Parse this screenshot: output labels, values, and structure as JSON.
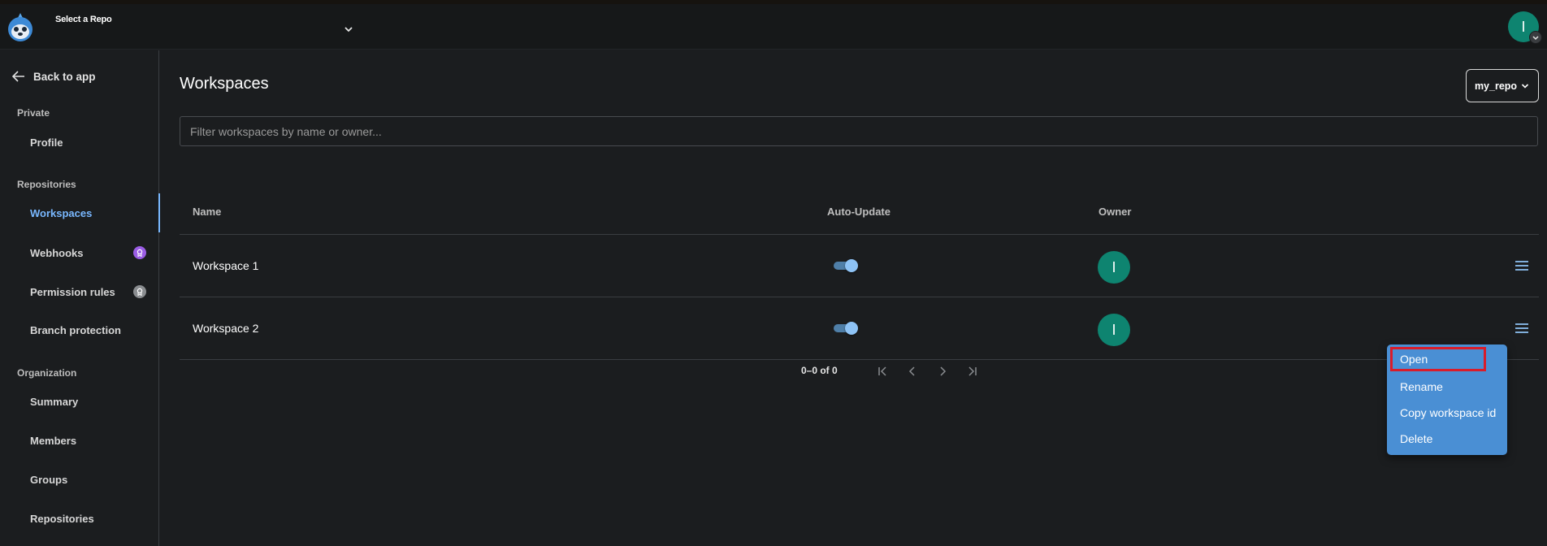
{
  "topbar": {
    "repo_selector_label": "Select a Repo",
    "user_initial": "I"
  },
  "sidebar": {
    "back_label": "Back to app",
    "sections": [
      {
        "title": "Private",
        "items": [
          {
            "label": "Profile"
          }
        ]
      },
      {
        "title": "Repositories",
        "items": [
          {
            "label": "Workspaces",
            "active": true
          },
          {
            "label": "Webhooks",
            "badge": "pro-purple"
          },
          {
            "label": "Permission rules",
            "badge": "pro-gray"
          },
          {
            "label": "Branch protection"
          }
        ]
      },
      {
        "title": "Organization",
        "items": [
          {
            "label": "Summary"
          },
          {
            "label": "Members"
          },
          {
            "label": "Groups"
          },
          {
            "label": "Repositories"
          }
        ]
      }
    ]
  },
  "main": {
    "title": "Workspaces",
    "repo_button_label": "my_repo",
    "filter_placeholder": "Filter workspaces by name or owner...",
    "filter_value": "",
    "table": {
      "columns": [
        "Name",
        "Auto-Update",
        "Owner"
      ],
      "rows": [
        {
          "name": "Workspace 1",
          "auto_update": true,
          "owner_initial": "I"
        },
        {
          "name": "Workspace 2",
          "auto_update": true,
          "owner_initial": "I"
        }
      ]
    },
    "pagination": {
      "summary": "0–0 of 0"
    }
  },
  "context_menu": {
    "items": [
      {
        "label": "Open",
        "highlighted": true
      },
      {
        "label": "Rename"
      },
      {
        "label": "Copy workspace id"
      },
      {
        "label": "Delete"
      }
    ]
  },
  "colors": {
    "accent": "#79b8ff",
    "avatar": "#0e8470",
    "menu_bg": "#4a8fd4",
    "highlight_box": "#d91c2a",
    "badge_purple": "#9b5de5"
  },
  "icons": [
    "app-logo-icon",
    "chevron-down-icon",
    "arrow-left-icon",
    "pro-badge-icon",
    "hamburger-menu-icon",
    "first-page-icon",
    "previous-page-icon",
    "next-page-icon",
    "last-page-icon"
  ]
}
